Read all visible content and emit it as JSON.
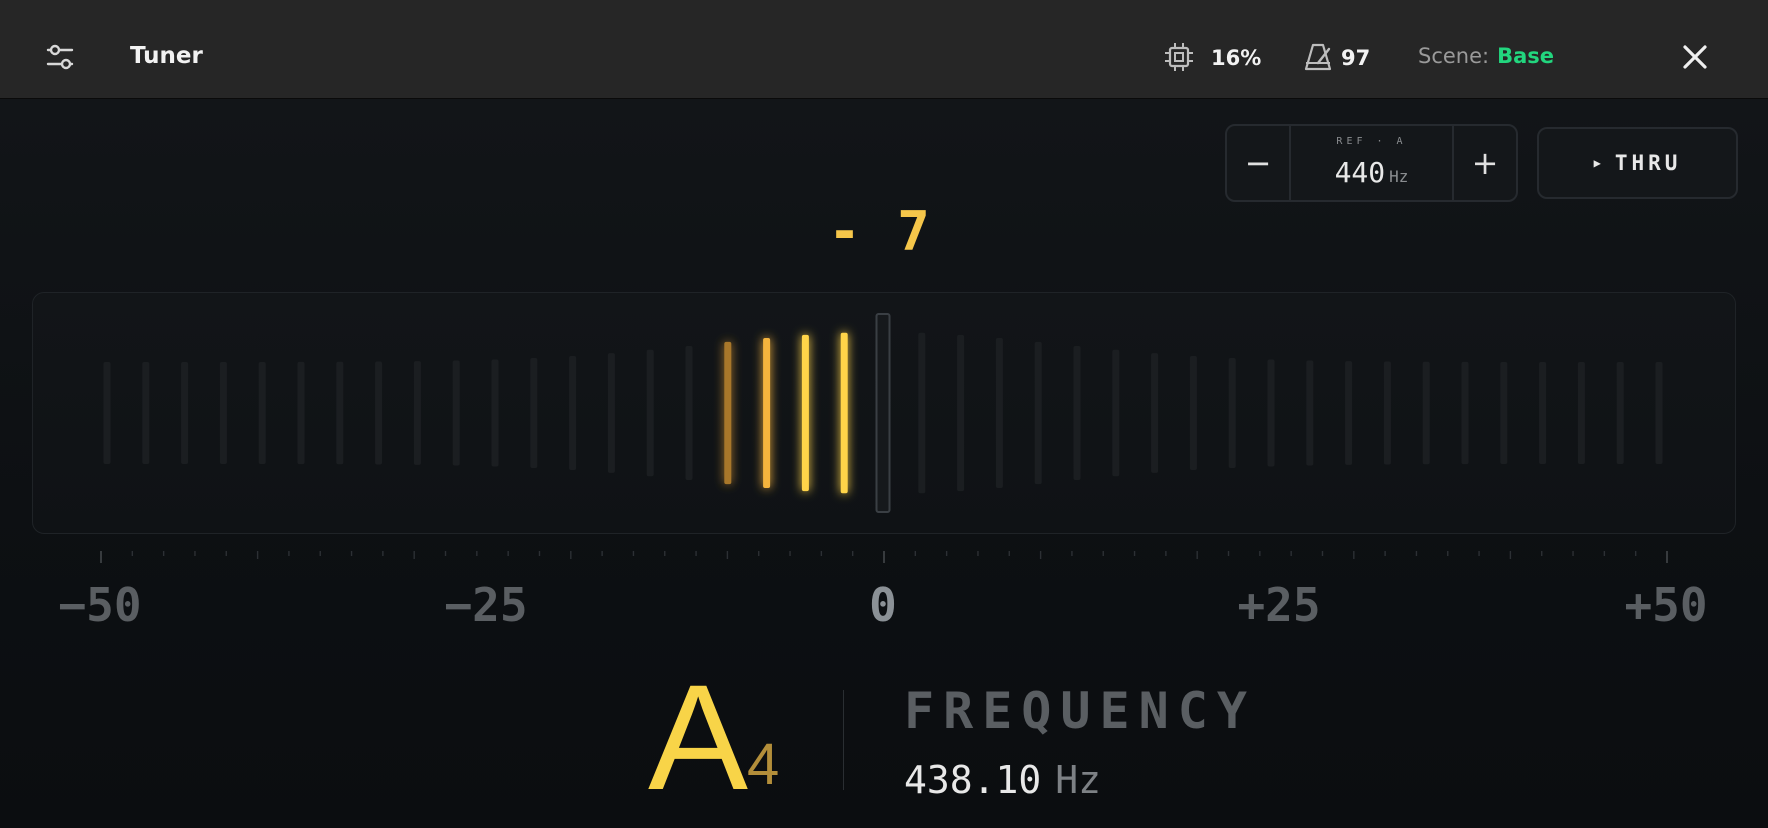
{
  "topbar": {
    "title": "Tuner",
    "cpu": "16%",
    "tempo": "97",
    "scene_label": "Scene:",
    "scene_value": "Base",
    "scene_color": "#22d67e",
    "icons": [
      "filter-settings-icon",
      "cpu-chip-icon",
      "metronome-icon",
      "close-icon"
    ]
  },
  "reference": {
    "label": "REF · A",
    "value": "440",
    "unit": "Hz",
    "minus": "−",
    "plus": "+"
  },
  "thru": {
    "arrow": "▶",
    "label": "THRU"
  },
  "tuning": {
    "cents_display": "- 7",
    "cents": -7,
    "accent_color": "#f5c64a"
  },
  "scale": {
    "labels": [
      "−50",
      "−25",
      "0",
      "+25",
      "+50"
    ]
  },
  "note": {
    "letter": "A",
    "octave": "4"
  },
  "frequency": {
    "label": "FREQUENCY",
    "value": "438.10",
    "unit": "Hz"
  }
}
